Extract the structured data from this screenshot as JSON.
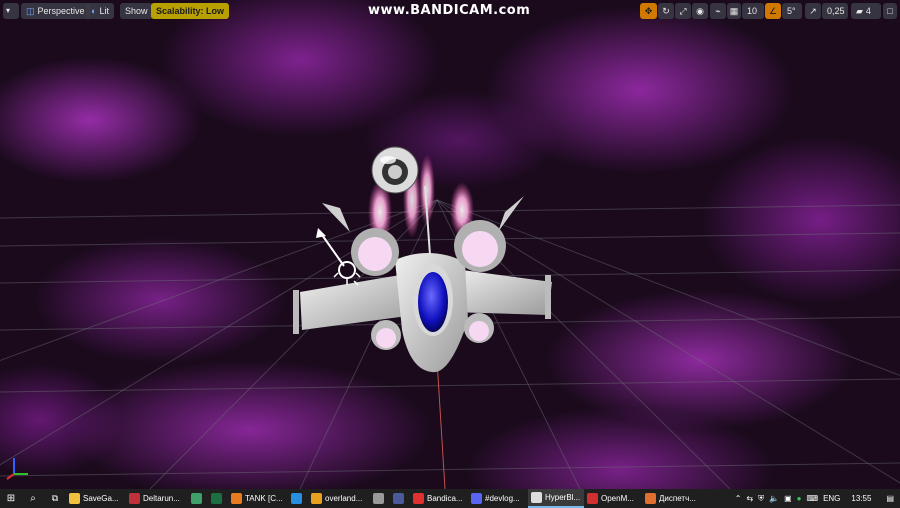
{
  "viewport": {
    "left_toolbar": {
      "menu_label": "",
      "perspective_label": "Perspective",
      "lit_label": "Lit",
      "show_label": "Show",
      "scalability_label": "Scalability: Low"
    },
    "right_toolbar": {
      "grid_snap_value": "10",
      "rotation_snap_value": "5°",
      "scale_snap_value": "0,25",
      "camera_speed_value": "4"
    },
    "watermark": "www.BANDICAM.com",
    "colors": {
      "nebula": "#a030b8",
      "warn_badge": "#b8a000",
      "active_snap": "#d07800"
    }
  },
  "taskbar": {
    "items": [
      {
        "label": "SaveGa...",
        "icon": "folder-icon",
        "color": "#f0c040"
      },
      {
        "label": "Deltarun...",
        "icon": "app-icon",
        "color": "#c0303a"
      },
      {
        "label": "",
        "icon": "git-icon",
        "color": "#3fa06a"
      },
      {
        "label": "",
        "icon": "excel-icon",
        "color": "#1d6f42"
      },
      {
        "label": "TANK [C...",
        "icon": "app-icon",
        "color": "#e87a20"
      },
      {
        "label": "",
        "icon": "vscode-icon",
        "color": "#2a8ee0"
      },
      {
        "label": "overland...",
        "icon": "app-icon",
        "color": "#e8a020"
      },
      {
        "label": "",
        "icon": "blender-icon",
        "color": "#999999"
      },
      {
        "label": "",
        "icon": "app-icon",
        "color": "#4a5a9a"
      },
      {
        "label": "Bandica...",
        "icon": "record-icon",
        "color": "#e03030"
      },
      {
        "label": "#devlog...",
        "icon": "discord-icon",
        "color": "#5865f2"
      },
      {
        "label": "HyperBl...",
        "icon": "unreal-icon",
        "color": "#dddddd"
      },
      {
        "label": "OpenM...",
        "icon": "app-icon",
        "color": "#d03030"
      },
      {
        "label": "Диспетч...",
        "icon": "app-icon",
        "color": "#e07030"
      }
    ],
    "tray": {
      "language": "ENG",
      "time": "13:55"
    }
  }
}
